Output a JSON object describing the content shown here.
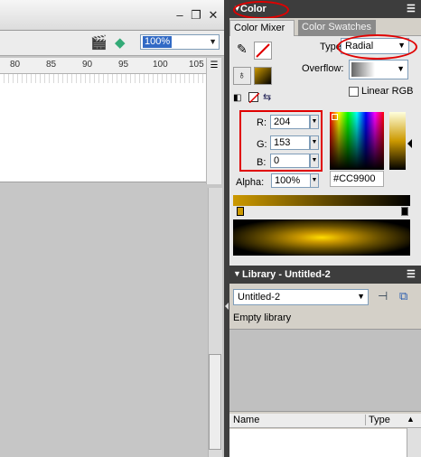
{
  "toolbar": {
    "zoom_value": "100%"
  },
  "timeline": {
    "ticks": [
      "80",
      "85",
      "90",
      "95",
      "100",
      "105"
    ]
  },
  "color_panel": {
    "title": "Color",
    "tabs": [
      "Color Mixer",
      "Color Swatches"
    ],
    "type_label": "Type:",
    "type_value": "Radial",
    "overflow_label": "Overflow:",
    "linear_rgb_label": "Linear RGB",
    "r_label": "R:",
    "r_value": "204",
    "g_label": "G:",
    "g_value": "153",
    "b_label": "B:",
    "b_value": "0",
    "alpha_label": "Alpha:",
    "alpha_value": "100%",
    "hex_value": "#CC9900",
    "gradient_colors": [
      "#cc9900",
      "#000000"
    ]
  },
  "library_panel": {
    "title": "Library - Untitled-2",
    "document_select": "Untitled-2",
    "status": "Empty library",
    "col_name": "Name",
    "col_type": "Type"
  },
  "colors": {
    "panel_header": "#3d3d3d",
    "annotation_red": "#e00000"
  }
}
